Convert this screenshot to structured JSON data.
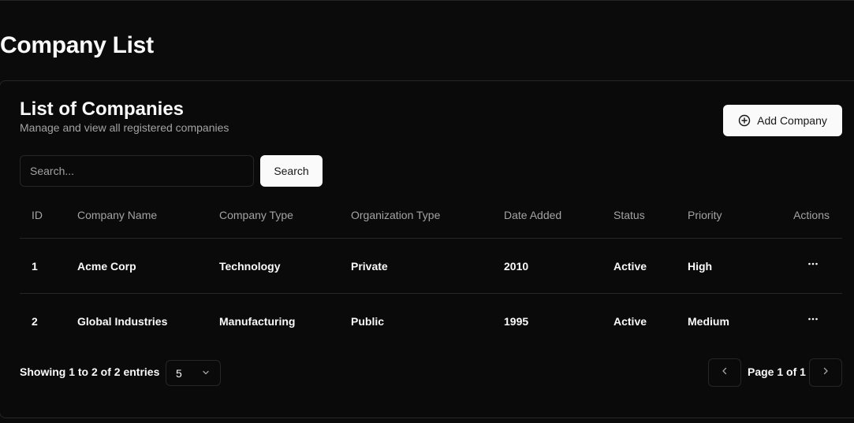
{
  "page": {
    "title": "Company List"
  },
  "card": {
    "title": "List of Companies",
    "description": "Manage and view all registered companies",
    "add_button_label": "Add Company"
  },
  "search": {
    "placeholder": "Search...",
    "value": "",
    "button_label": "Search"
  },
  "table": {
    "headers": {
      "id": "ID",
      "name": "Company Name",
      "type": "Company Type",
      "org": "Organization Type",
      "date": "Date Added",
      "status": "Status",
      "priority": "Priority",
      "actions": "Actions"
    },
    "rows": [
      {
        "id": "1",
        "name": "Acme Corp",
        "type": "Technology",
        "org": "Private",
        "date": "2010",
        "status": "Active",
        "priority": "High"
      },
      {
        "id": "2",
        "name": "Global Industries",
        "type": "Manufacturing",
        "org": "Public",
        "date": "1995",
        "status": "Active",
        "priority": "Medium"
      }
    ],
    "row_action_icon": "more-horizontal-icon"
  },
  "footer": {
    "showing_text": "Showing 1 to 2 of 2 entries",
    "page_size": "5",
    "page_label": "Page 1 of 1",
    "prev_icon": "chevron-left-icon",
    "next_icon": "chevron-right-icon"
  },
  "colors": {
    "background": "#0b0b0b",
    "card_background": "#0a0a0a",
    "border": "#262626",
    "text_primary": "#fafafa",
    "text_muted": "#a3a3a3",
    "button_background": "#fafafa",
    "button_text": "#171717"
  }
}
